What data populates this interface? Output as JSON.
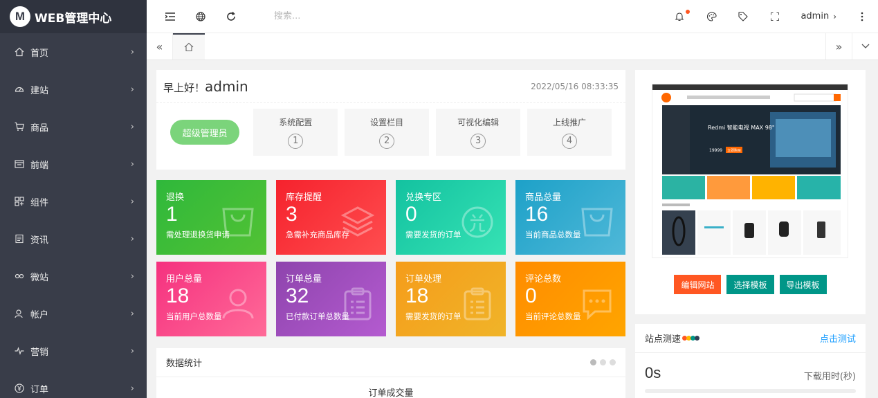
{
  "brand": {
    "logo_letter": "M",
    "title": "WEB管理中心"
  },
  "sidebar": {
    "items": [
      {
        "label": "首页",
        "icon": "home-icon"
      },
      {
        "label": "建站",
        "icon": "dashboard-icon"
      },
      {
        "label": "商品",
        "icon": "cart-icon"
      },
      {
        "label": "前端",
        "icon": "window-icon"
      },
      {
        "label": "组件",
        "icon": "component-icon"
      },
      {
        "label": "资讯",
        "icon": "news-icon"
      },
      {
        "label": "微站",
        "icon": "link-icon"
      },
      {
        "label": "帐户",
        "icon": "user-icon"
      },
      {
        "label": "营销",
        "icon": "pulse-icon"
      },
      {
        "label": "订单",
        "icon": "yen-icon"
      }
    ]
  },
  "header": {
    "search_placeholder": "搜索...",
    "username": "admin",
    "accent": "#ff5722"
  },
  "welcome": {
    "greeting": "早上好！",
    "name": "admin",
    "datetime": "2022/05/16 08:33:35",
    "role": "超级管理员",
    "steps": [
      {
        "label": "系统配置",
        "num": "1"
      },
      {
        "label": "设置栏目",
        "num": "2"
      },
      {
        "label": "可视化编辑",
        "num": "3"
      },
      {
        "label": "上线推广",
        "num": "4"
      }
    ]
  },
  "cards": [
    {
      "title": "退换",
      "value": "1",
      "desc": "需处理退换货申请",
      "color": "#2fb83b",
      "color2": "#52c234",
      "icon": "bag-icon"
    },
    {
      "title": "库存提醒",
      "value": "3",
      "desc": "急需补充商品库存",
      "color": "#f5222d",
      "color2": "#ff4d4f",
      "icon": "layers-icon"
    },
    {
      "title": "兑换专区",
      "value": "0",
      "desc": "需要发货的订单",
      "color": "#13c2a0",
      "color2": "#36e2b4",
      "icon": "exchange-icon"
    },
    {
      "title": "商品总量",
      "value": "16",
      "desc": "当前商品总数量",
      "color": "#1da1c8",
      "color2": "#4fb8d8",
      "icon": "bag-icon"
    },
    {
      "title": "用户总量",
      "value": "18",
      "desc": "当前用户总数量",
      "color": "#f5317f",
      "color2": "#ff6a98",
      "icon": "user-icon"
    },
    {
      "title": "订单总量",
      "value": "32",
      "desc": "已付款订单总数量",
      "color": "#8e44ad",
      "color2": "#b45bd0",
      "icon": "clipboard-icon"
    },
    {
      "title": "订单处理",
      "value": "18",
      "desc": "需要发货的订单",
      "color": "#f59c1a",
      "color2": "#f0b429",
      "icon": "clipboard-icon"
    },
    {
      "title": "评论总数",
      "value": "0",
      "desc": "当前评论总数量",
      "color": "#ff8c00",
      "color2": "#ffa500",
      "icon": "comment-icon"
    }
  ],
  "stats": {
    "title": "数据统计",
    "subtitle": "订单成交量"
  },
  "template": {
    "buttons": [
      {
        "label": "编辑网站",
        "style": "orange"
      },
      {
        "label": "选择模板",
        "style": "teal"
      },
      {
        "label": "导出模板",
        "style": "teal"
      }
    ],
    "preview": {
      "banner_title": "Redmi 智能电视 MAX 98\"",
      "price": "19999",
      "cta": "立即购买"
    }
  },
  "speed": {
    "title": "站点测速",
    "link": "点击测试",
    "value": "0s",
    "label": "下载用时(秒)",
    "dot_colors": [
      "#ff5722",
      "#ffb800",
      "#009688",
      "#2f4056"
    ]
  }
}
